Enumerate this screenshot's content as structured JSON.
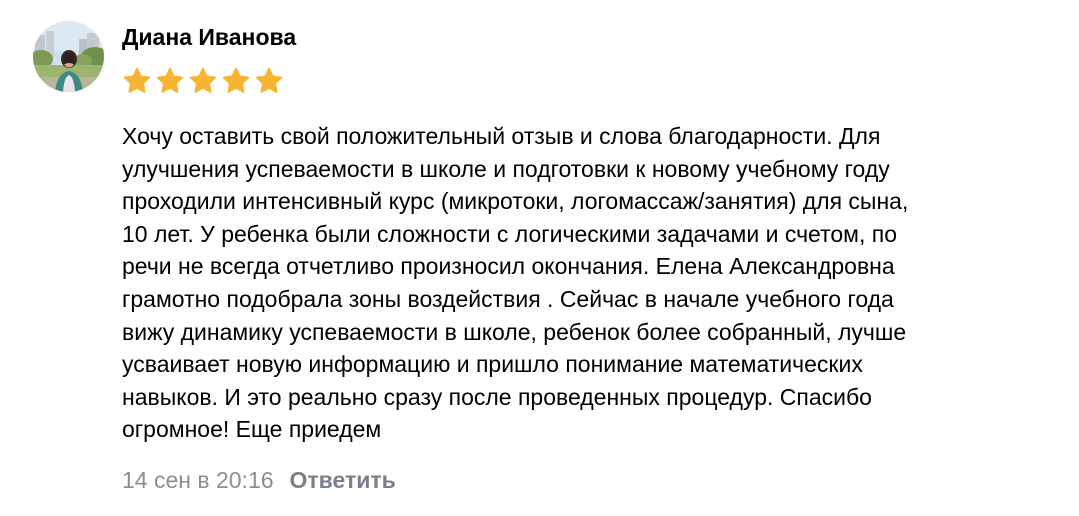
{
  "review": {
    "author": "Диана Иванова",
    "rating": 5,
    "rating_max": 5,
    "star_color": "#f8b433",
    "text_lines": [
      "Хочу оставить свой положительный отзыв и слова благодарности. Для",
      "улучшения успеваемости в школе и подготовки к новому учебному году",
      "проходили интенсивный курс (микротоки, логомассаж/занятия) для сына,",
      "10 лет. У ребенка были сложности с логическими задачами и счетом, по",
      "речи не всегда отчетливо произносил окончания. Елена Александровна",
      "грамотно подобрала зоны воздействия . Сейчас в начале учебного года",
      "вижу динамику успеваемости в школе, ребенок более собранный, лучше",
      "усваивает новую информацию и пришло понимание математических",
      "навыков. И это реально сразу после проведенных процедур. Спасибо",
      "огромное! Еще приедем"
    ],
    "timestamp": "14 сен в 20:16",
    "reply_label": "Ответить"
  }
}
